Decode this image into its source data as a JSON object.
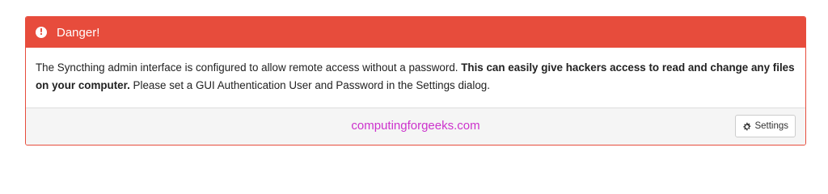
{
  "alert": {
    "title": "Danger!",
    "icon": "exclamation-circle-icon",
    "color": "#e74c3c",
    "message_part1": "The Syncthing admin interface is configured to allow remote access without a password. ",
    "message_bold": "This can easily give hackers access to read and change any files on your computer.",
    "message_part2": " Please set a GUI Authentication User and Password in the Settings dialog."
  },
  "footer": {
    "watermark": "computingforgeeks.com",
    "settings_label": "Settings",
    "settings_icon": "gear-icon"
  }
}
